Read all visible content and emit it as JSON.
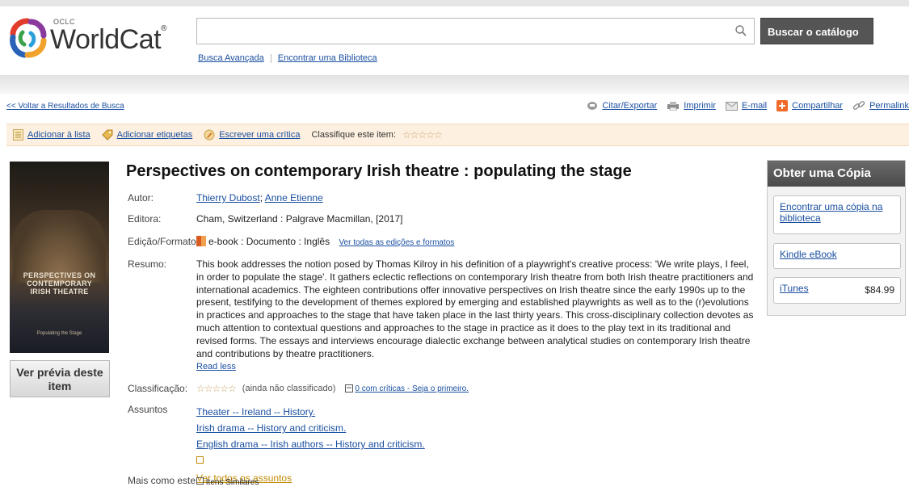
{
  "header": {
    "logo_small": "OCLC",
    "logo_text": "WorldCat",
    "logo_tm": "®",
    "search_value": "",
    "search_button": "Buscar o catálogo em",
    "links": [
      "Busca Avançada",
      "Encontrar uma Biblioteca"
    ]
  },
  "nav": {
    "back": "<< Voltar a Resultados de Busca",
    "actions": [
      "Citar/Exportar",
      "Imprimir",
      "E-mail",
      "Compartilhar",
      "Permalink"
    ]
  },
  "toolbar": {
    "add_list": "Adicionar à lista",
    "add_tags": "Adicionar etiquetas",
    "write_review": "Escrever uma crítica",
    "rate_label": "Classifique este item:",
    "stars": "☆☆☆☆☆"
  },
  "cover": {
    "line1": "PERSPECTIVES ON",
    "line2": "CONTEMPORARY",
    "line3": "IRISH THEATRE",
    "subtitle": "Populating the Stage"
  },
  "preview_button": "Ver prévia deste item",
  "record": {
    "title": "Perspectives on contemporary Irish theatre : populating the stage",
    "labels": {
      "author": "Autor:",
      "publisher": "Editora:",
      "edition": "Edição/Formato",
      "summary": "Resumo:",
      "rating": "Classificação:",
      "subjects": "Assuntos",
      "more": "Mais como este"
    },
    "authors": [
      "Thierry Dubost",
      "Anne Etienne"
    ],
    "author_sep": ";",
    "publisher": "Cham, Switzerland : Palgrave Macmillan, [2017]",
    "format": "e-book : Documento : Inglês",
    "all_editions": "Ver todas as edições e formatos",
    "summary": "This book addresses the notion posed by Thomas Kilroy in his definition of a playwright's creative process: 'We write plays, I feel, in order to populate the stage'. It gathers eclectic reflections on contemporary Irish theatre from both Irish theatre practitioners and international academics. The eighteen contributions offer innovative perspectives on Irish theatre since the early 1990s up to the present, testifying to the development of themes explored by emerging and established playwrights as well as to the (r)evolutions in practices and approaches to the stage that have taken place in the last thirty years. This cross-disciplinary collection devotes as much attention to contextual questions and approaches to the stage in practice as it does to the play text in its traditional and revised forms. The essays and interviews encourage dialectic exchange between analytical studies on contemporary Irish theatre and contributions by theatre practitioners.",
    "read_less": "Read less",
    "rating_stars": "☆☆☆☆☆",
    "rating_text": "(ainda não classificado)",
    "reviews": "0 com críticas - Seja o primeiro.",
    "subjects": [
      "Theater -- Ireland -- History.",
      "Irish drama -- History and criticism.",
      "English drama -- Irish authors -- History and criticism."
    ],
    "see_all_subjects": "Ver todos os assuntos",
    "similar": "Itens Similares"
  },
  "copy_panel": {
    "title": "Obter uma Cópia",
    "find_copy": "Encontrar uma cópia na biblioteca",
    "kindle": "Kindle eBook",
    "itunes": "iTunes",
    "itunes_price": "$84.99"
  },
  "colors": {
    "link": "#1a4fa0",
    "toolbar_bg": "#fdf0e0",
    "button_dark": "#555555",
    "panel_header": "#4a4a4a"
  }
}
